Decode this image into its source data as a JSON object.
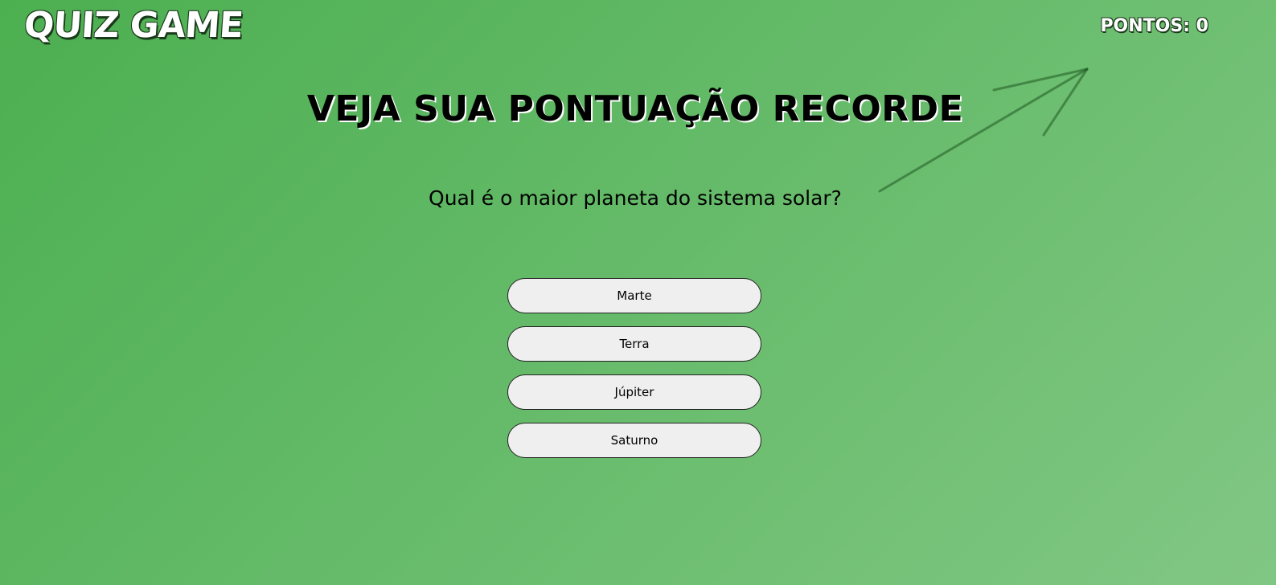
{
  "header": {
    "logo": "QUIZ GAME",
    "score_label": "PONTOS: 0"
  },
  "main": {
    "headline": "VEJA SUA PONTUAÇÃO RECORDE",
    "question": "Qual é o maior planeta do sistema solar?",
    "answers": [
      "Marte",
      "Terra",
      "Júpiter",
      "Saturno"
    ]
  },
  "colors": {
    "background_start": "#4caf50",
    "background_end": "#81c784",
    "button_bg": "#efefef",
    "text": "#000000"
  }
}
